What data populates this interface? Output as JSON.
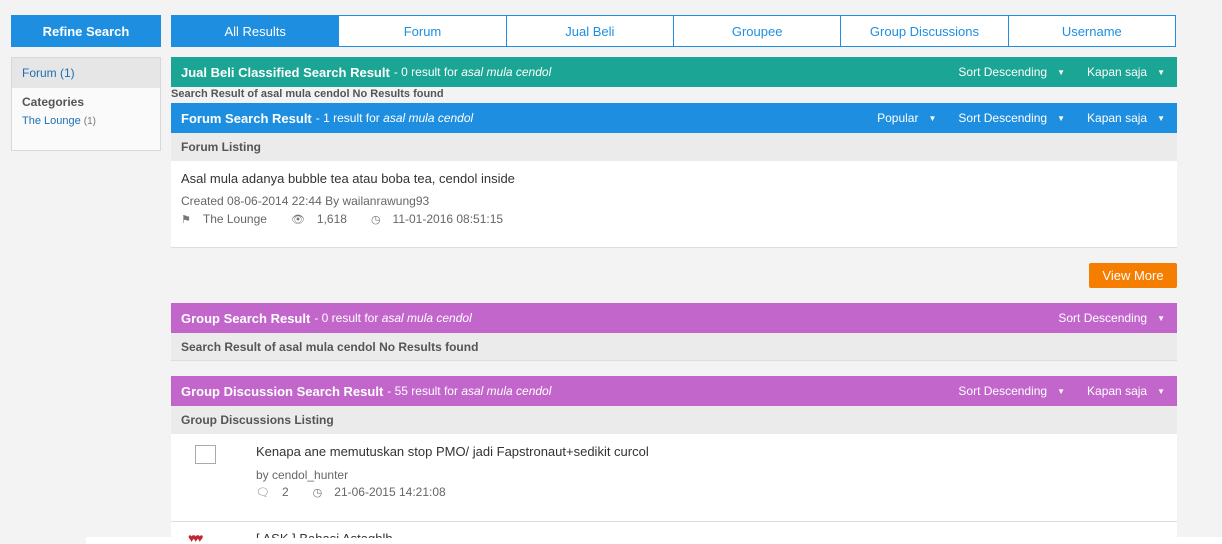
{
  "sidebar": {
    "refine_label": "Refine Search",
    "forum_label": "Forum (1)",
    "categories_title": "Categories",
    "category_item": "The Lounge",
    "category_count": "(1)"
  },
  "tabs": [
    "All Results",
    "Forum",
    "Jual Beli",
    "Groupee",
    "Group Discussions",
    "Username"
  ],
  "jualbeli": {
    "title": "Jual Beli Classified Search Result",
    "summary": "- 0 result for",
    "query": "asal mula cendol",
    "sort": "Sort Descending",
    "time": "Kapan saja",
    "no_result": "Search Result of asal mula cendol No Results found"
  },
  "forum": {
    "title": "Forum Search Result",
    "summary": "- 1 result for",
    "query": "asal mula cendol",
    "popular": "Popular",
    "sort": "Sort Descending",
    "time": "Kapan saja",
    "listing": "Forum Listing",
    "thread_title": "Asal mula adanya bubble tea atau boba tea, cendol inside",
    "created": "Created 08-06-2014 22:44 By wailanrawung93",
    "category": "The Lounge",
    "views": "1,618",
    "last_post": "11-01-2016 08:51:15",
    "view_more": "View More"
  },
  "group": {
    "title": "Group Search Result",
    "summary": "- 0 result for",
    "query": "asal mula cendol",
    "sort": "Sort Descending",
    "no_result": "Search Result of asal mula cendol No Results found"
  },
  "group_discussion": {
    "title": "Group Discussion Search Result",
    "summary": "- 55 result for",
    "query": "asal mula cendol",
    "sort": "Sort Descending",
    "time": "Kapan saja",
    "listing": "Group Discussions Listing",
    "item1_title": "Kenapa ane memutuskan stop PMO/ jadi Fapstronaut+sedikit curcol",
    "item1_by": "by cendol_hunter",
    "item1_comments": "2",
    "item1_time": "21-06-2015 14:21:08",
    "item2_title": "[ ASK ] Bahasi Astaghlh"
  },
  "icons": {
    "caret": "caret-down-icon",
    "tag": "tags-icon",
    "eye": "eye-icon",
    "clock": "clock-icon",
    "comment": "comment-icon"
  }
}
